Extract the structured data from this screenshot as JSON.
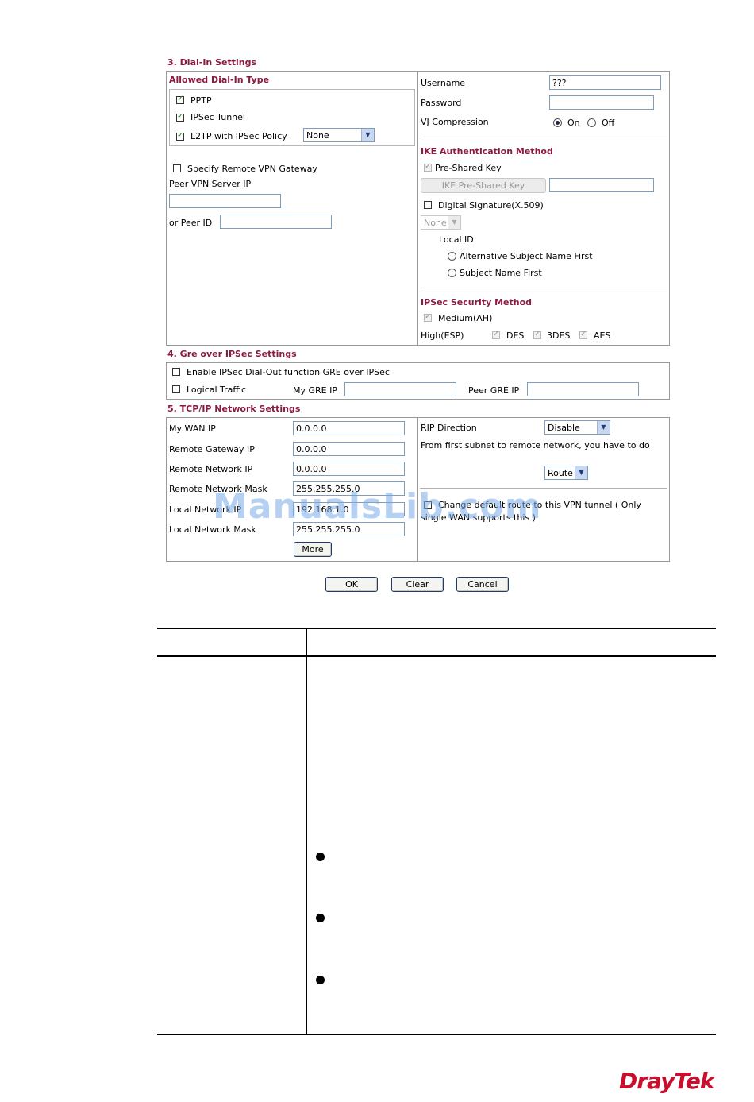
{
  "dialin": {
    "title": "3. Dial-In Settings",
    "allowed_title": "Allowed Dial-In Type",
    "pptp": "PPTP",
    "ipsec_tunnel": "IPSec Tunnel",
    "l2tp": "L2TP with IPSec Policy",
    "l2tp_policy": "None",
    "specify_remote": "Specify Remote VPN Gateway",
    "peer_vpn_ip": "Peer VPN Server IP",
    "peer_id": "or Peer ID",
    "username_label": "Username",
    "username_value": "???",
    "password_label": "Password",
    "vj_label": "VJ Compression",
    "vj_on": "On",
    "vj_off": "Off",
    "ike_title": "IKE Authentication Method",
    "pre_shared": "Pre-Shared Key",
    "ike_psk_button": "IKE Pre-Shared Key",
    "digital_sig": "Digital Signature(X.509)",
    "digital_sig_select": "None",
    "local_id": "Local ID",
    "alt_subject": "Alternative Subject Name First",
    "subject_name": "Subject Name First",
    "ipsec_title": "IPSec Security Method",
    "medium": "Medium(AH)",
    "high": "High(ESP)",
    "des": "DES",
    "tdes": "3DES",
    "aes": "AES"
  },
  "gre": {
    "title": "4. Gre over IPSec Settings",
    "enable": "Enable IPSec Dial-Out function GRE over IPSec",
    "logical": "Logical Traffic",
    "my_gre": "My GRE IP",
    "peer_gre": "Peer GRE IP"
  },
  "tcpip": {
    "title": "5. TCP/IP Network Settings",
    "my_wan_label": "My WAN IP",
    "my_wan_value": "0.0.0.0",
    "gw_label": "Remote Gateway IP",
    "gw_value": "0.0.0.0",
    "rnet_label": "Remote Network IP",
    "rnet_value": "0.0.0.0",
    "rmask_label": "Remote Network Mask",
    "rmask_value": "255.255.255.0",
    "lnet_label": "Local Network IP",
    "lnet_value": "192.168.1.0",
    "lmask_label": "Local Network Mask",
    "lmask_value": "255.255.255.0",
    "more": "More",
    "rip_label": "RIP Direction",
    "rip_value": "Disable",
    "subnet_text": "From first subnet to remote network, you have to do",
    "route_value": "Route",
    "change_text_1": "Change default route to this VPN tunnel ( Only",
    "change_text_2": "single WAN supports this )"
  },
  "buttons": {
    "ok": "OK",
    "clear": "Clear",
    "cancel": "Cancel"
  },
  "watermark": "ManualsLib.com",
  "logo": "DrayTek"
}
